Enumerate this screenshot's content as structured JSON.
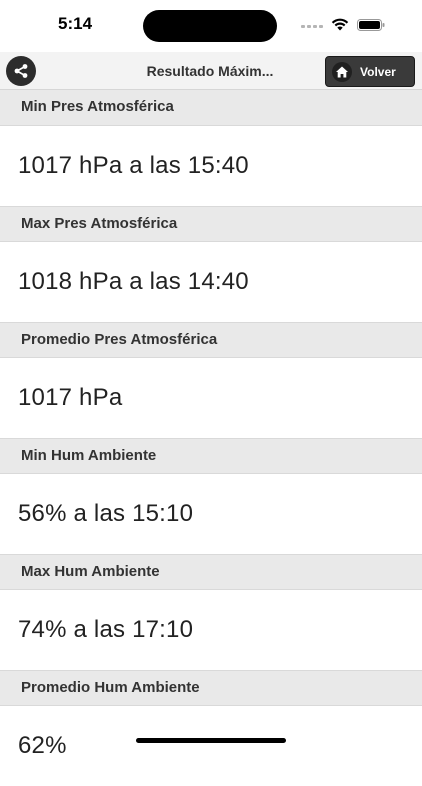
{
  "status_bar": {
    "time": "5:14"
  },
  "header": {
    "title": "Resultado Máxim...",
    "back_label": "Volver"
  },
  "icons": {
    "share": "share-icon",
    "home": "home-icon",
    "wifi": "wifi-icon",
    "battery": "battery-icon"
  },
  "sections": [
    {
      "title": "Min Pres Atmosférica",
      "value": "1017 hPa a las 15:40"
    },
    {
      "title": "Max Pres Atmosférica",
      "value": "1018 hPa a las 14:40"
    },
    {
      "title": "Promedio Pres Atmosférica",
      "value": "1017 hPa"
    },
    {
      "title": "Min Hum Ambiente",
      "value": "56% a las 15:10"
    },
    {
      "title": "Max Hum Ambiente",
      "value": "74% a las 17:10"
    },
    {
      "title": "Promedio Hum Ambiente",
      "value": "62%"
    }
  ]
}
